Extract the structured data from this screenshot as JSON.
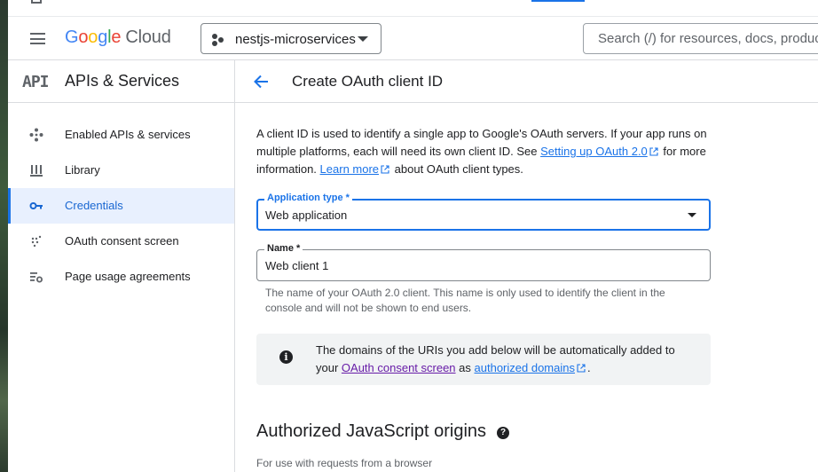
{
  "header": {
    "logo_parts": [
      "G",
      "o",
      "o",
      "g",
      "l",
      "e"
    ],
    "logo_cloud": "Cloud",
    "project": "nestjs-microservices",
    "search_placeholder": "Search (/) for resources, docs, products"
  },
  "sidebar": {
    "api_badge": "API",
    "title": "APIs & Services",
    "items": [
      {
        "label": "Enabled APIs & services",
        "icon": "diamond-dots-icon"
      },
      {
        "label": "Library",
        "icon": "library-icon"
      },
      {
        "label": "Credentials",
        "icon": "key-icon",
        "active": true
      },
      {
        "label": "OAuth consent screen",
        "icon": "dots-grid-icon"
      },
      {
        "label": "Page usage agreements",
        "icon": "settings-list-icon"
      }
    ]
  },
  "page": {
    "title": "Create OAuth client ID",
    "intro_1": "A client ID is used to identify a single app to Google's OAuth servers. If your app runs on multiple platforms, each will need its own client ID. See ",
    "intro_link_1": "Setting up OAuth 2.0",
    "intro_2": " for more information. ",
    "intro_link_2": "Learn more",
    "intro_3": " about OAuth client types.",
    "app_type_label": "Application type *",
    "app_type_value": "Web application",
    "name_label": "Name *",
    "name_value": "Web client 1",
    "name_hint": "The name of your OAuth 2.0 client. This name is only used to identify the client in the console and will not be shown to end users.",
    "info_1": "The domains of the URIs you add below will be automatically added to your ",
    "info_link_1": "OAuth consent screen",
    "info_2": " as ",
    "info_link_2": "authorized domains",
    "info_3": ".",
    "section_title": "Authorized JavaScript origins",
    "section_sub": "For use with requests from a browser"
  },
  "colors": {
    "accent": "#1a73e8",
    "active_bg": "#e8f0fe",
    "visited_link": "#681da8"
  }
}
